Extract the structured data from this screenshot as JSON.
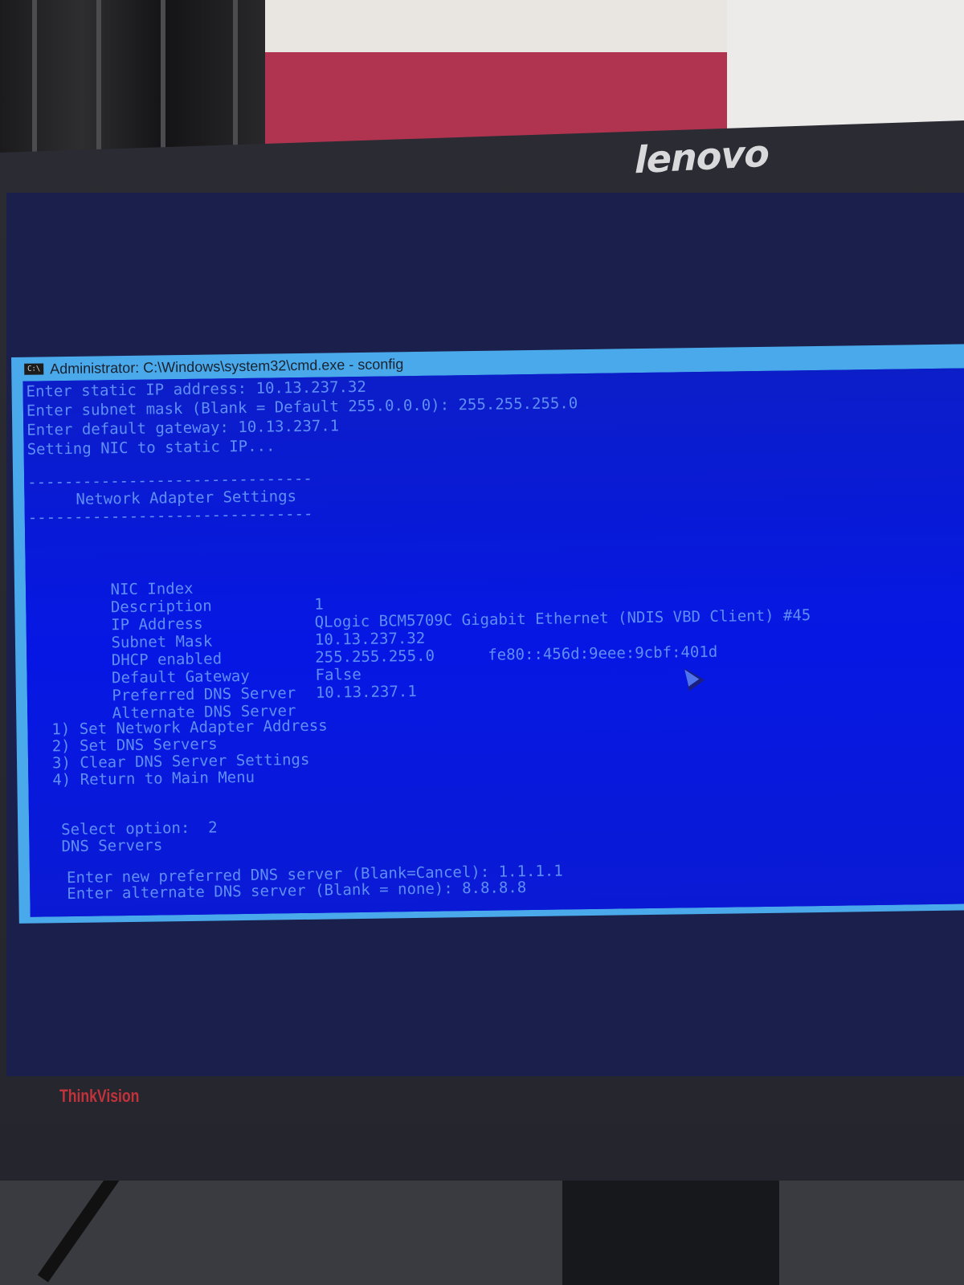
{
  "monitor": {
    "brand": "lenovo",
    "model_label": "ThinkVision"
  },
  "window": {
    "title": "Administrator: C:\\Windows\\system32\\cmd.exe - sconfig",
    "icon_label": "C:\\"
  },
  "console": {
    "prompt_ip": "Enter static IP address: 10.13.237.32",
    "prompt_mask": "Enter subnet mask (Blank = Default 255.0.0.0): 255.255.255.0",
    "prompt_gateway": "Enter default gateway: 10.13.237.1",
    "status": "Setting NIC to static IP...",
    "divider": "-------------------------------",
    "section_title": "Network Adapter Settings",
    "settings": [
      {
        "label": "NIC Index",
        "value": "1",
        "extra": ""
      },
      {
        "label": "Description",
        "value": "QLogic BCM5709C Gigabit Ethernet (NDIS VBD Client) #45",
        "extra": ""
      },
      {
        "label": "IP Address",
        "value": "10.13.237.32",
        "extra": "fe80::456d:9eee:9cbf:401d"
      },
      {
        "label": "Subnet Mask",
        "value": "255.255.255.0",
        "extra": ""
      },
      {
        "label": "DHCP enabled",
        "value": "False",
        "extra": ""
      },
      {
        "label": "Default Gateway",
        "value": "10.13.237.1",
        "extra": ""
      },
      {
        "label": "Preferred DNS Server",
        "value": "",
        "extra": ""
      },
      {
        "label": "Alternate DNS Server",
        "value": "",
        "extra": ""
      }
    ],
    "menu": [
      "1) Set Network Adapter Address",
      "2) Set DNS Servers",
      "3) Clear DNS Server Settings",
      "4) Return to Main Menu"
    ],
    "select_prompt": "Select option:  2",
    "dns_heading": "DNS Servers",
    "prompt_preferred_dns": "Enter new preferred DNS server (Blank=Cancel): 1.1.1.1",
    "prompt_alternate_dns": "Enter alternate DNS server (Blank = none): 8.8.8.8"
  }
}
